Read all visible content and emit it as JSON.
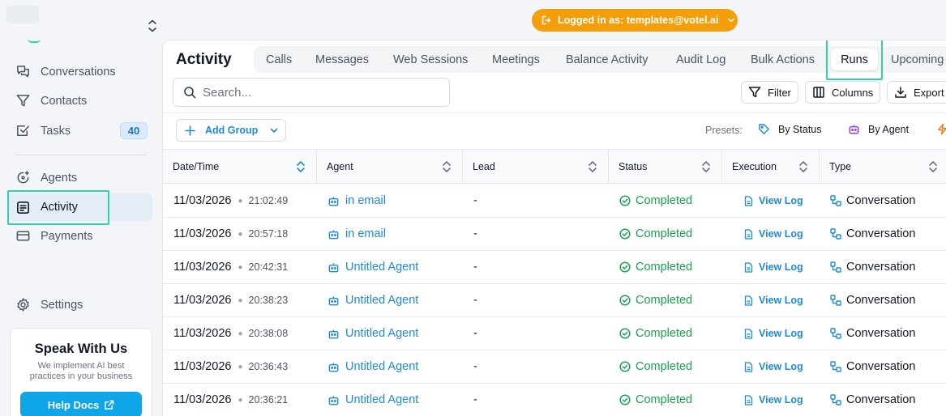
{
  "sidebar": {
    "nav": [
      {
        "label": "Conversations",
        "icon": "chat-icon"
      },
      {
        "label": "Contacts",
        "icon": "funnel-icon"
      },
      {
        "label": "Tasks",
        "icon": "check-square-icon",
        "badge": "40"
      },
      {
        "label": "Agents",
        "icon": "agent-sparkle-icon"
      },
      {
        "label": "Activity",
        "icon": "document-list-icon",
        "active": true
      },
      {
        "label": "Payments",
        "icon": "credit-card-icon"
      },
      {
        "label": "Settings",
        "icon": "gear-icon"
      }
    ],
    "promo": {
      "title": "Speak With Us",
      "text": "We implement AI best practices in your business",
      "button": "Help Docs"
    }
  },
  "login_pill": {
    "text": "Logged in as: templates@votel.ai"
  },
  "main": {
    "title": "Activity",
    "tabs": [
      "Calls",
      "Messages",
      "Web Sessions",
      "Meetings",
      "Balance Activity",
      "Audit Log",
      "Bulk Actions",
      "Runs",
      "Upcoming"
    ],
    "active_tab": "Runs",
    "search_placeholder": "Search...",
    "buttons": {
      "filter": "Filter",
      "columns": "Columns",
      "export": "Export"
    },
    "add_group": "Add Group",
    "presets_label": "Presets:",
    "presets": [
      "By Status",
      "By Agent"
    ]
  },
  "table": {
    "columns": [
      "Date/Time",
      "Agent",
      "Lead",
      "Status",
      "Execution",
      "Type"
    ],
    "rows": [
      {
        "date": "11/03/2026",
        "time": "21:02:49",
        "agent": "in email",
        "lead": "-",
        "status": "Completed",
        "execution": "View Log",
        "type": "Conversation"
      },
      {
        "date": "11/03/2026",
        "time": "20:57:18",
        "agent": "in email",
        "lead": "-",
        "status": "Completed",
        "execution": "View Log",
        "type": "Conversation"
      },
      {
        "date": "11/03/2026",
        "time": "20:42:31",
        "agent": "Untitled Agent",
        "lead": "-",
        "status": "Completed",
        "execution": "View Log",
        "type": "Conversation"
      },
      {
        "date": "11/03/2026",
        "time": "20:38:23",
        "agent": "Untitled Agent",
        "lead": "-",
        "status": "Completed",
        "execution": "View Log",
        "type": "Conversation"
      },
      {
        "date": "11/03/2026",
        "time": "20:38:08",
        "agent": "Untitled Agent",
        "lead": "-",
        "status": "Completed",
        "execution": "View Log",
        "type": "Conversation"
      },
      {
        "date": "11/03/2026",
        "time": "20:36:43",
        "agent": "Untitled Agent",
        "lead": "-",
        "status": "Completed",
        "execution": "View Log",
        "type": "Conversation"
      },
      {
        "date": "11/03/2026",
        "time": "20:36:21",
        "agent": "Untitled Agent",
        "lead": "-",
        "status": "Completed",
        "execution": "View Log",
        "type": "Conversation"
      }
    ]
  },
  "colors": {
    "accent": "#1d8bd8",
    "highlight": "#2fd3ab",
    "login_pill": "#f59e0b",
    "status_completed": "#16a34a",
    "promo_button": "#0ea5e9"
  }
}
